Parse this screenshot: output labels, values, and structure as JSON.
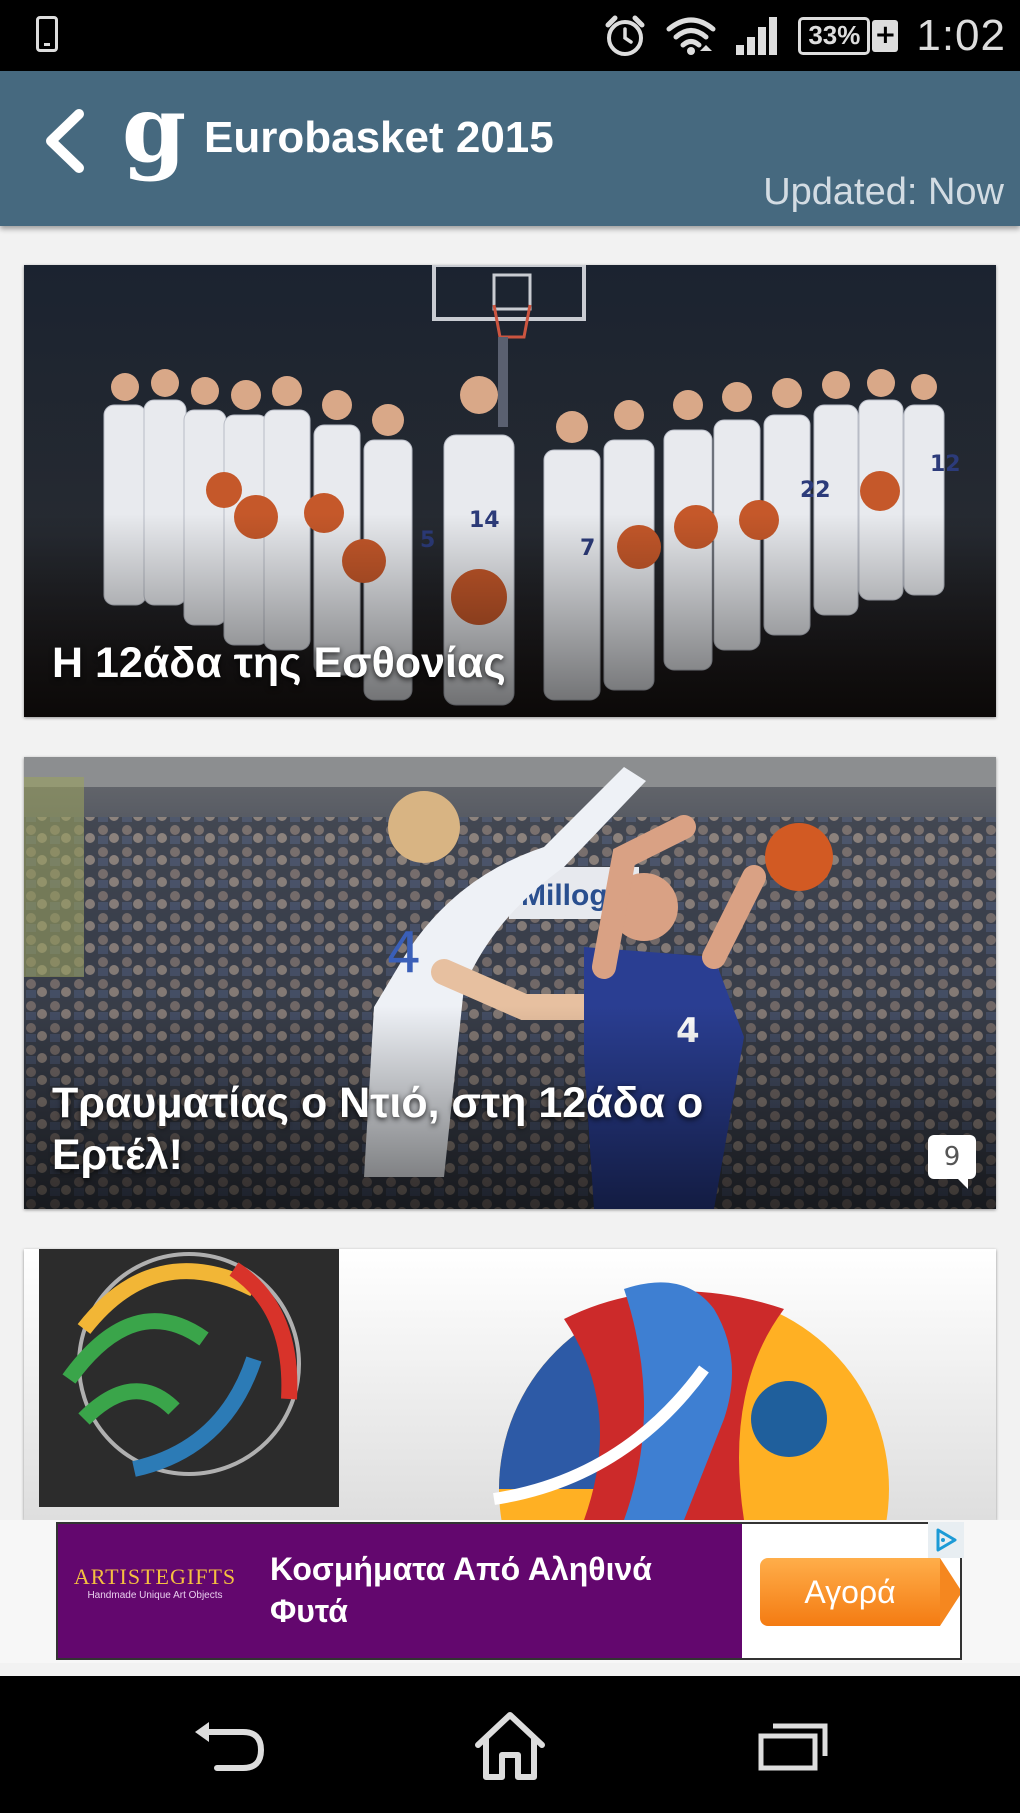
{
  "status_bar": {
    "battery": "33%",
    "battery_plus": "+",
    "time": "1:02",
    "icons": [
      "phone-icon",
      "alarm-icon",
      "wifi-icon",
      "signal-icon",
      "battery-icon"
    ]
  },
  "app_bar": {
    "title": "Eurobasket 2015",
    "updated": "Updated: Now",
    "logo": "g",
    "color": "#46697f"
  },
  "articles": [
    {
      "title": "Η 12άδα της Εσθονίας"
    },
    {
      "title": "Τραυματίας ο Ντιό, στη 12άδα ο Ερτέλ!",
      "comments": "9"
    },
    {
      "title": ""
    }
  ],
  "ad": {
    "brand": "ARTISTEGIFTS",
    "brand_tagline": "Handmade Unique Art Objects",
    "text": "Κοσμήματα Από Αληθινά Φυτά",
    "button": "Αγορά",
    "background": "#63076e",
    "button_color": "#f47b12"
  },
  "nav_bar": {
    "icons": [
      "back-icon",
      "home-icon",
      "recent-apps-icon"
    ]
  }
}
